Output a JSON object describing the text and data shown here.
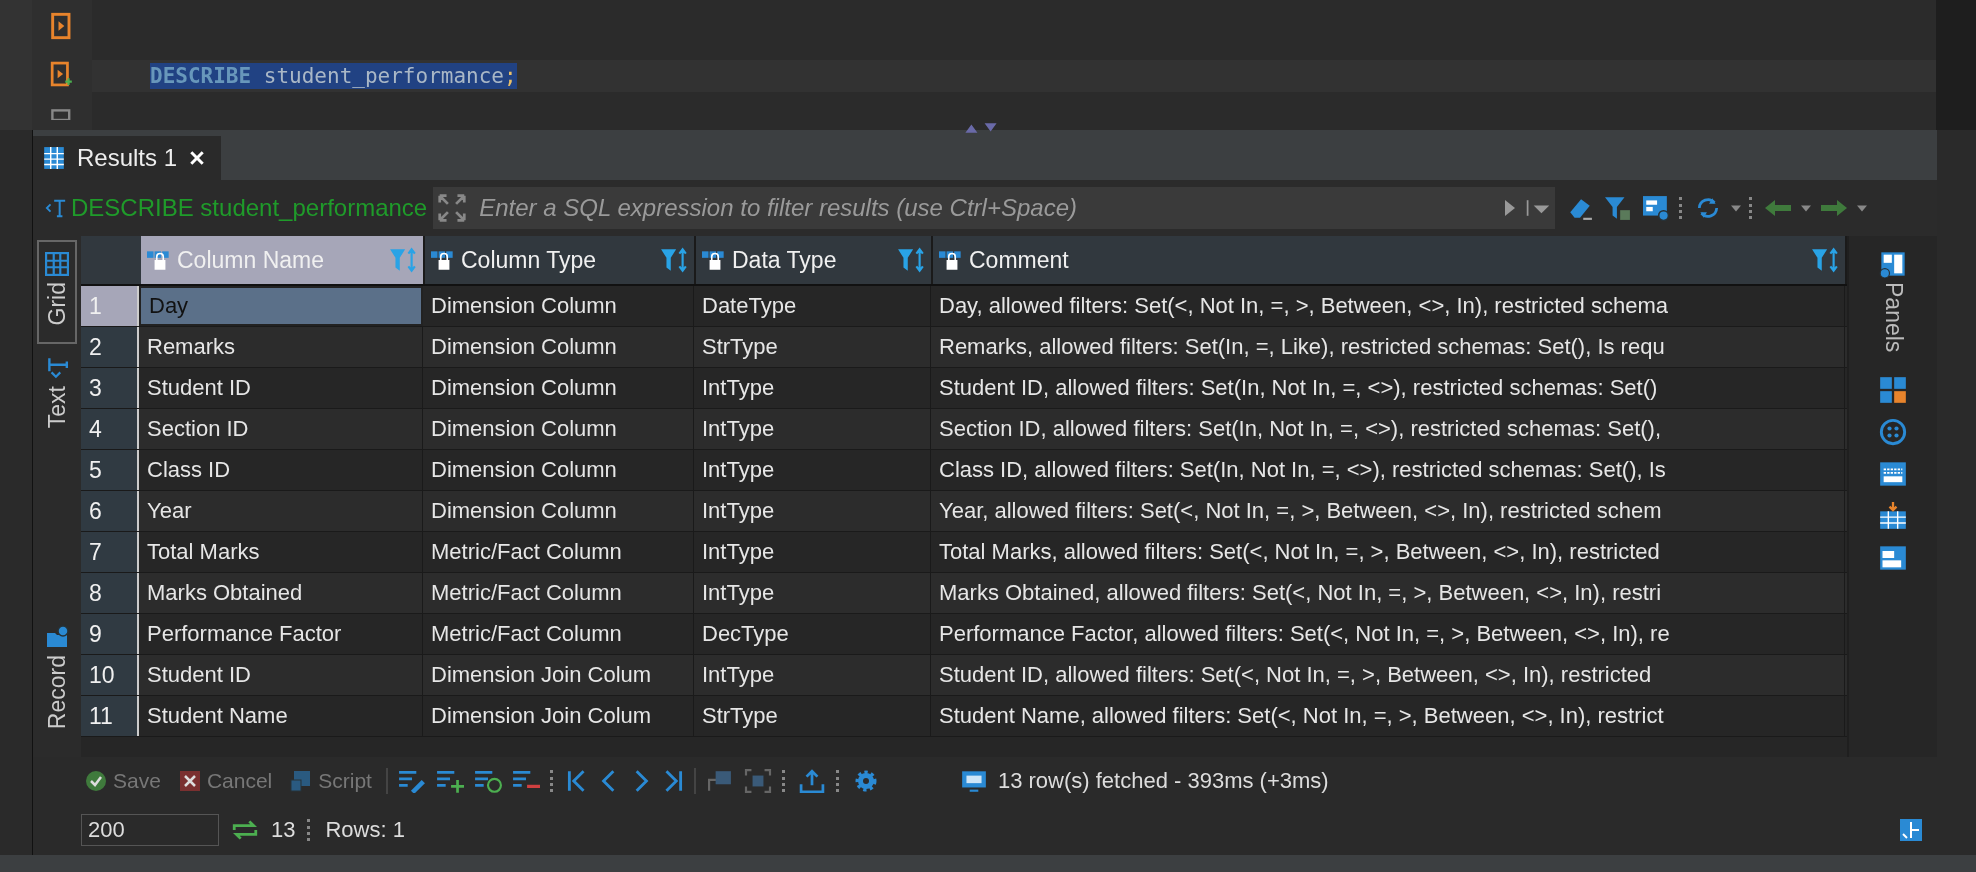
{
  "editor": {
    "lines": [
      {
        "selected": true,
        "tokens": [
          {
            "kind": "keyword",
            "text": "DESCRIBE"
          },
          {
            "kind": "identifier",
            "text": " student_performance"
          },
          {
            "kind": "punct",
            "text": ";"
          }
        ]
      }
    ]
  },
  "results_tab": {
    "label": "Results 1",
    "selected": true
  },
  "filter_bar": {
    "query": "DESCRIBE student_performance",
    "placeholder": "Enter a SQL expression to filter results (use Ctrl+Space)"
  },
  "view_tabs": [
    {
      "label": "Grid",
      "selected": true
    },
    {
      "label": "Text",
      "selected": false
    },
    {
      "label": "Record",
      "selected": false
    }
  ],
  "table": {
    "columns": [
      {
        "label": "Column Name",
        "selected": true
      },
      {
        "label": "Column Type",
        "selected": false
      },
      {
        "label": "Data Type",
        "selected": false
      },
      {
        "label": "Comment",
        "selected": false
      }
    ],
    "rows": [
      {
        "number": "1",
        "selected": true,
        "cells": [
          "Day",
          "Dimension Column",
          "DateType",
          "Day, allowed filters: Set(<, Not In, =, >, Between, <>, In), restricted schema"
        ]
      },
      {
        "number": "2",
        "selected": false,
        "cells": [
          "Remarks",
          "Dimension Column",
          "StrType",
          "Remarks, allowed filters: Set(In, =, Like), restricted schemas: Set(), Is requ"
        ]
      },
      {
        "number": "3",
        "selected": false,
        "cells": [
          "Student ID",
          "Dimension Column",
          "IntType",
          "Student ID, allowed filters: Set(In, Not In, =, <>), restricted schemas: Set()"
        ]
      },
      {
        "number": "4",
        "selected": false,
        "cells": [
          "Section ID",
          "Dimension Column",
          "IntType",
          "Section ID, allowed filters: Set(In, Not In, =, <>), restricted schemas: Set(),"
        ]
      },
      {
        "number": "5",
        "selected": false,
        "cells": [
          "Class ID",
          "Dimension Column",
          "IntType",
          "Class ID, allowed filters: Set(In, Not In, =, <>), restricted schemas: Set(), Is"
        ]
      },
      {
        "number": "6",
        "selected": false,
        "cells": [
          "Year",
          "Dimension Column",
          "IntType",
          "Year, allowed filters: Set(<, Not In, =, >, Between, <>, In), restricted schem"
        ]
      },
      {
        "number": "7",
        "selected": false,
        "cells": [
          "Total Marks",
          "Metric/Fact Column",
          "IntType",
          "Total Marks, allowed filters: Set(<, Not In, =, >, Between, <>, In), restricted"
        ]
      },
      {
        "number": "8",
        "selected": false,
        "cells": [
          "Marks Obtained",
          "Metric/Fact Column",
          "IntType",
          "Marks Obtained, allowed filters: Set(<, Not In, =, >, Between, <>, In), restri"
        ]
      },
      {
        "number": "9",
        "selected": false,
        "cells": [
          "Performance Factor",
          "Metric/Fact Column",
          "DecType",
          "Performance Factor, allowed filters: Set(<, Not In, =, >, Between, <>, In), re"
        ]
      },
      {
        "number": "10",
        "selected": false,
        "cells": [
          "Student ID",
          "Dimension Join Colum",
          "IntType",
          "Student ID, allowed filters: Set(<, Not In, =, >, Between, <>, In), restricted"
        ]
      },
      {
        "number": "11",
        "selected": false,
        "cells": [
          "Student Name",
          "Dimension Join Colum",
          "StrType",
          "Student Name, allowed filters: Set(<, Not In, =, >, Between, <>, In), restrict"
        ]
      }
    ]
  },
  "side_panel": {
    "label": "Panels"
  },
  "edit_buttons": [
    {
      "label": "Save",
      "disabled": true,
      "kind": "save"
    },
    {
      "label": "Cancel",
      "disabled": true,
      "kind": "cancel"
    },
    {
      "label": "Script",
      "disabled": true,
      "kind": "script"
    }
  ],
  "status": "13 row(s) fetched - 393ms (+3ms)",
  "footer": {
    "fetch_size": "200",
    "count": "13",
    "rows_label": "Rows: 1"
  }
}
